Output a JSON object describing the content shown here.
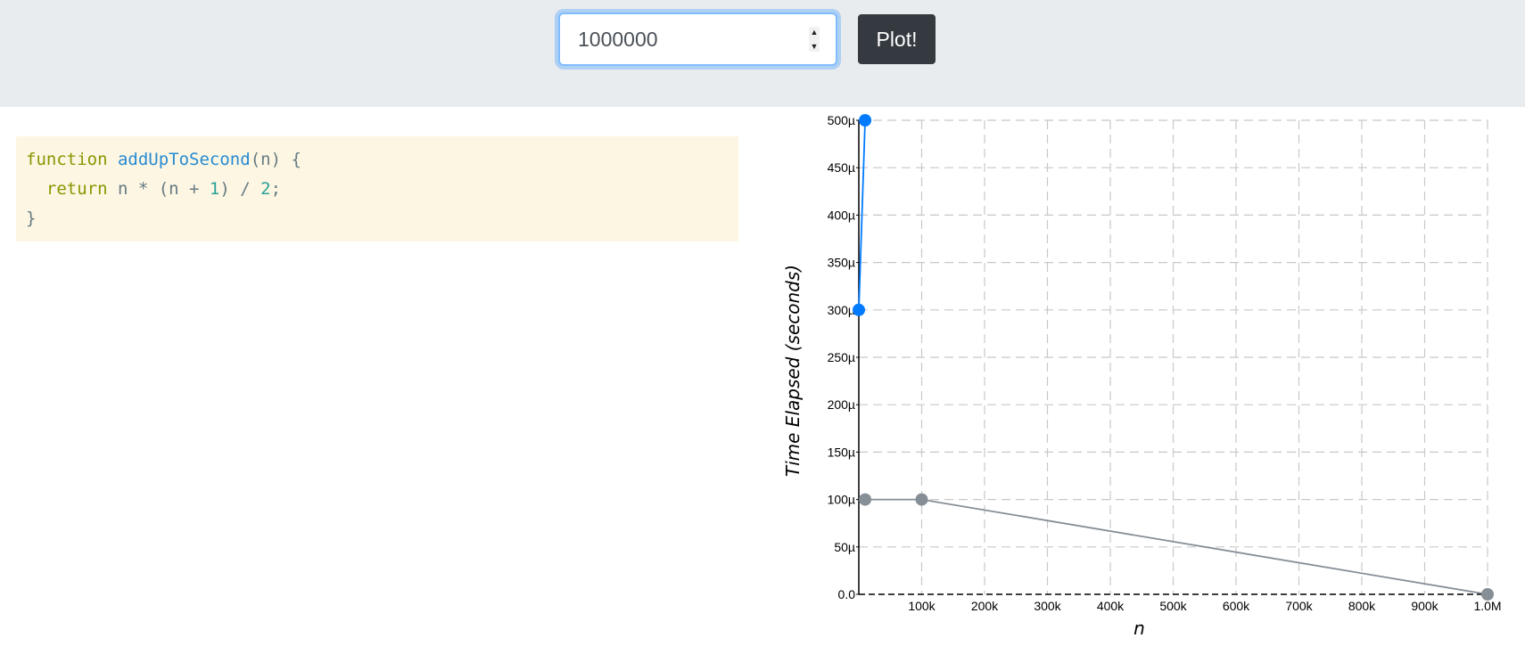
{
  "controls": {
    "n_input_value": "1000000",
    "spin_up": "▲",
    "spin_down": "▼",
    "plot_label": "Plot!"
  },
  "code": {
    "line1_keyword": "function",
    "line1_name": "addUpToSecond",
    "line1_rest": "(n) {",
    "line2_indent": "  ",
    "line2_keyword": "return",
    "line2_part1": " n * (n + ",
    "line2_num1": "1",
    "line2_part2": ") / ",
    "line2_num2": "2",
    "line2_end": ";",
    "line3": "}"
  },
  "colors": {
    "series_blue": "#007bff",
    "series_gray": "#868e96",
    "grid": "#c8c8c8",
    "code_bg": "#fdf6e3"
  },
  "chart_data": {
    "type": "line",
    "xlabel": "n",
    "ylabel": "Time Elapsed (seconds)",
    "xlim": [
      0,
      1000000
    ],
    "ylim": [
      0,
      0.0005
    ],
    "x_ticks": [
      100000,
      200000,
      300000,
      400000,
      500000,
      600000,
      700000,
      800000,
      900000,
      1000000
    ],
    "x_tick_labels": [
      "100k",
      "200k",
      "300k",
      "400k",
      "500k",
      "600k",
      "700k",
      "800k",
      "900k",
      "1.0M"
    ],
    "y_ticks": [
      0,
      5e-05,
      0.0001,
      0.00015,
      0.0002,
      0.00025,
      0.0003,
      0.00035,
      0.0004,
      0.00045,
      0.0005
    ],
    "y_tick_labels": [
      "0.0",
      "50µ",
      "100µ",
      "150µ",
      "200µ",
      "250µ",
      "300µ",
      "350µ",
      "400µ",
      "450µ",
      "500µ"
    ],
    "grid": true,
    "series": [
      {
        "color": "#007bff",
        "points": [
          [
            0,
            0.0003
          ],
          [
            10000,
            0.0005
          ]
        ]
      },
      {
        "color": "#868e96",
        "points": [
          [
            10000,
            0.0001
          ],
          [
            100000,
            0.0001
          ],
          [
            1000000,
            0.0
          ]
        ]
      }
    ]
  }
}
